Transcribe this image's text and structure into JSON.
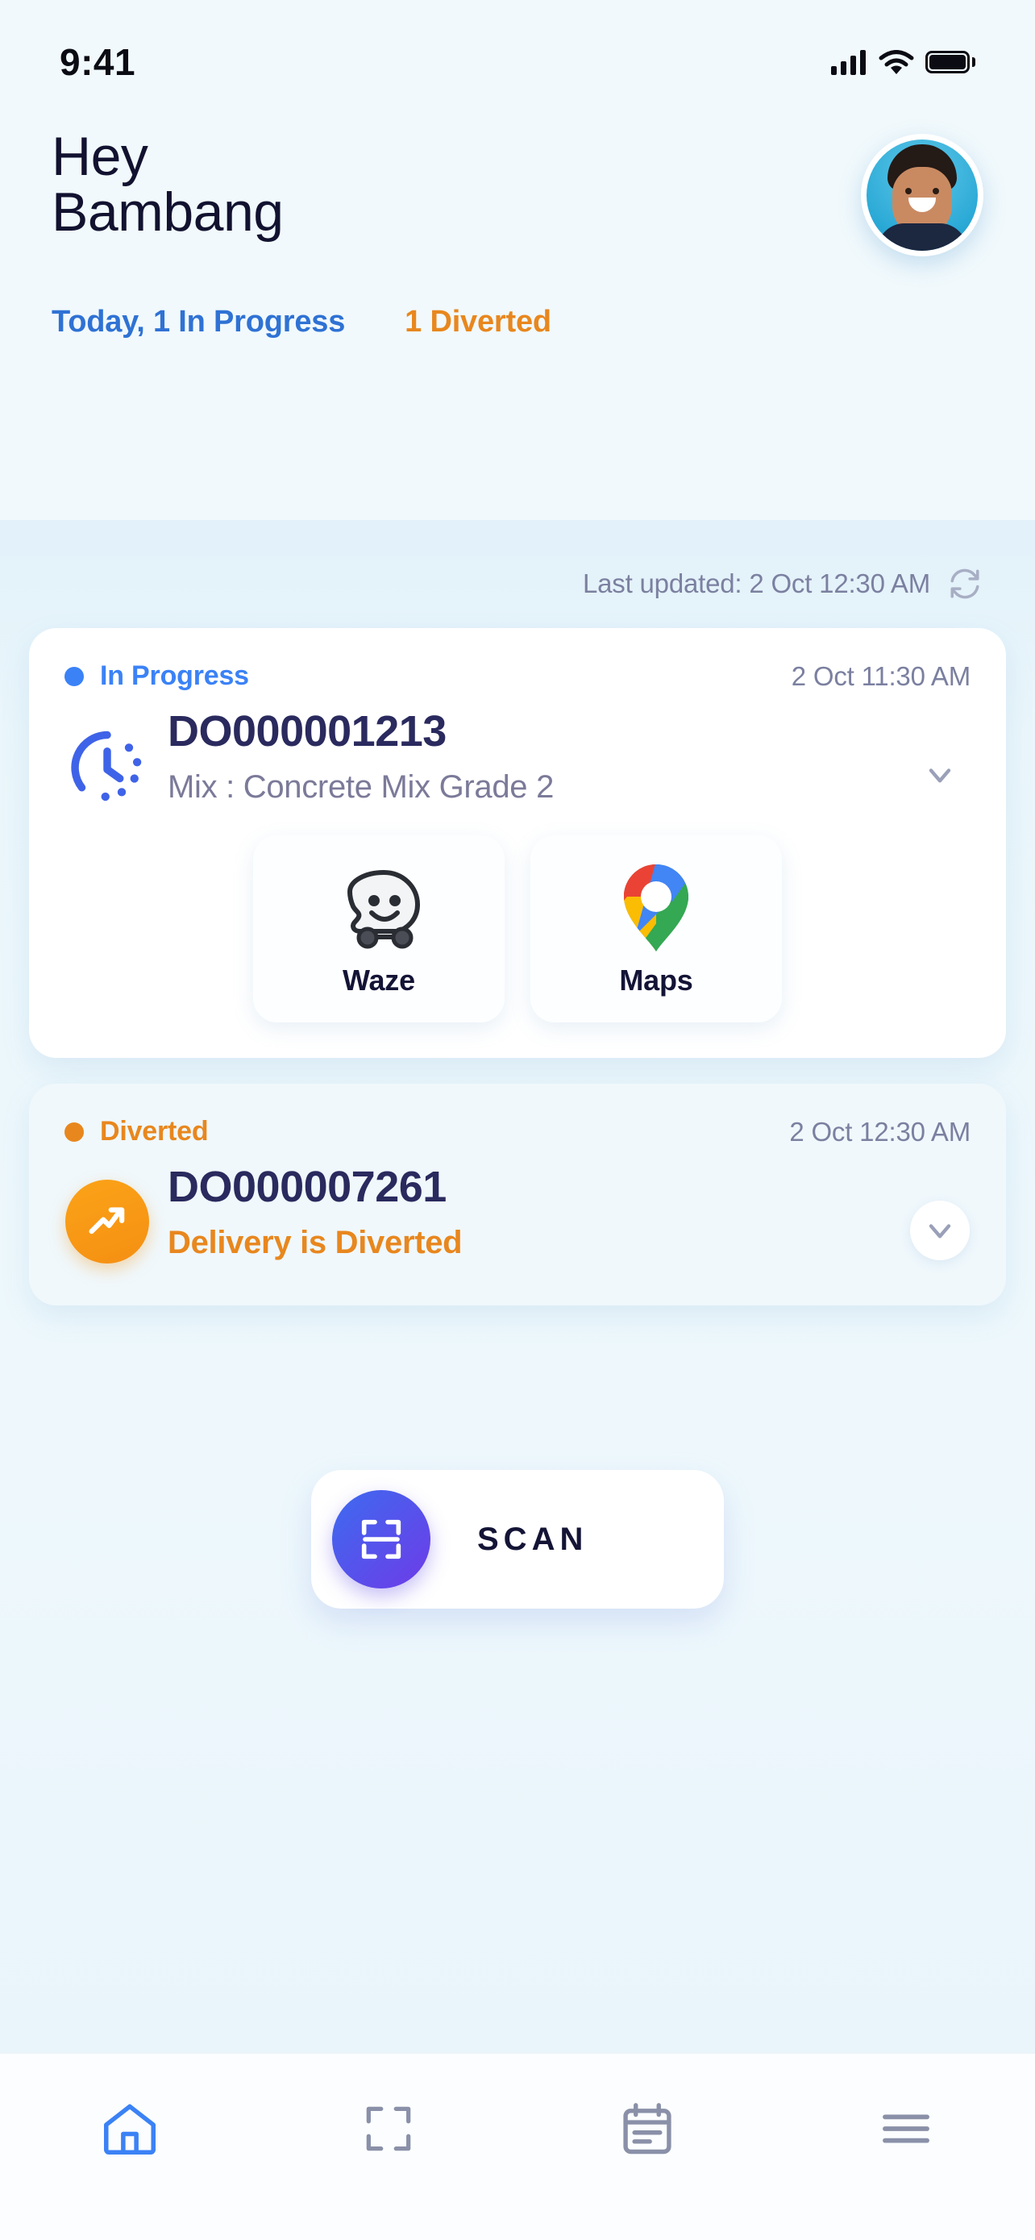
{
  "status_bar": {
    "time": "9:41",
    "cellular_icon": "cellular-signal-icon",
    "wifi_icon": "wifi-icon",
    "battery_icon": "battery-full-icon"
  },
  "header": {
    "greeting_line1": "Hey",
    "greeting_line2": "Bambang",
    "avatar_icon": "user-avatar"
  },
  "tabs": [
    {
      "label": "Today, 1 In Progress",
      "color": "#2F72D4",
      "state": "active"
    },
    {
      "label": "1 Diverted",
      "color": "#E8871E",
      "state": "inactive"
    }
  ],
  "sync": {
    "last_updated": "Last updated: 2 Oct 12:30 AM",
    "refresh_icon": "refresh-icon"
  },
  "cards": [
    {
      "status": "In Progress",
      "status_color": "#3B82F6",
      "timestamp": "2 Oct 11:30 AM",
      "do_number": "DO000001213",
      "subtitle": "Mix : Concrete Mix Grade 2",
      "icon": "clock-progress-icon",
      "chevron": "chevron-down-icon",
      "apps": [
        {
          "label": "Waze",
          "icon": "waze-icon"
        },
        {
          "label": "Maps",
          "icon": "google-maps-icon"
        }
      ]
    },
    {
      "status": "Diverted",
      "status_color": "#E8871E",
      "timestamp": "2 Oct 12:30 AM",
      "do_number": "DO000007261",
      "subtitle": "Delivery is Diverted",
      "icon": "diverted-arrow-icon",
      "chevron": "chevron-down-icon"
    }
  ],
  "scan_button": {
    "label": "SCAN",
    "icon": "scan-frame-icon",
    "gradient_start": "#3D6BEF",
    "gradient_end": "#6E3BE8"
  },
  "bottom_nav": [
    {
      "name": "home",
      "icon": "home-icon",
      "active": true,
      "color": "#3B82F6"
    },
    {
      "name": "scan",
      "icon": "scan-frame-icon",
      "active": false,
      "color": "#8A90A8"
    },
    {
      "name": "orders",
      "icon": "calendar-list-icon",
      "active": false,
      "color": "#8A90A8"
    },
    {
      "name": "menu",
      "icon": "hamburger-menu-icon",
      "active": false,
      "color": "#8A90A8"
    }
  ]
}
